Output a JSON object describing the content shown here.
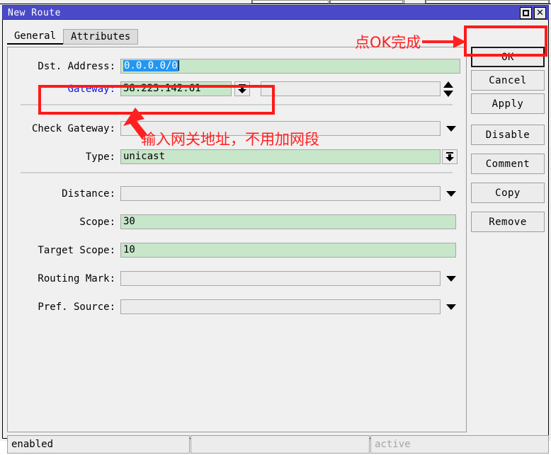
{
  "window": {
    "title": "New Route",
    "maximize_icon": "maximize-icon",
    "close_icon": "close-icon",
    "close_glyph": "✕"
  },
  "tabs": [
    {
      "label": "General",
      "active": true
    },
    {
      "label": "Attributes",
      "active": false
    }
  ],
  "form": {
    "fields": [
      {
        "key": "dst_address",
        "label": "Dst. Address:",
        "value": "0.0.0.0/0",
        "style": "green",
        "selected": true,
        "control": "none"
      },
      {
        "key": "gateway",
        "label": "Gateway:",
        "value": "58.223.142.61",
        "style": "green",
        "selected": false,
        "control": "combo-button",
        "label_link": true
      },
      {
        "key": "gateway_extra",
        "label": "",
        "value": "",
        "style": "plain",
        "selected": false,
        "control": "spinner"
      },
      {
        "key": "check_gateway",
        "label": "Check Gateway:",
        "value": "",
        "style": "plain",
        "selected": false,
        "control": "dropdown"
      },
      {
        "key": "type",
        "label": "Type:",
        "value": "unicast",
        "style": "green",
        "selected": false,
        "control": "combo-button"
      },
      {
        "key": "distance",
        "label": "Distance:",
        "value": "",
        "style": "plain",
        "selected": false,
        "control": "dropdown"
      },
      {
        "key": "scope",
        "label": "Scope:",
        "value": "30",
        "style": "green",
        "selected": false,
        "control": "none"
      },
      {
        "key": "target_scope",
        "label": "Target Scope:",
        "value": "10",
        "style": "green",
        "selected": false,
        "control": "none"
      },
      {
        "key": "routing_mark",
        "label": "Routing Mark:",
        "value": "",
        "style": "plain",
        "selected": false,
        "control": "dropdown"
      },
      {
        "key": "pref_source",
        "label": "Pref. Source:",
        "value": "",
        "style": "plain",
        "selected": false,
        "control": "dropdown"
      }
    ]
  },
  "buttons": [
    {
      "label": "OK",
      "default": true
    },
    {
      "label": "Cancel",
      "default": false
    },
    {
      "label": "Apply",
      "default": false
    },
    {
      "label": "Disable",
      "default": false
    },
    {
      "label": "Comment",
      "default": false
    },
    {
      "label": "Copy",
      "default": false
    },
    {
      "label": "Remove",
      "default": false
    }
  ],
  "status": {
    "left": "enabled",
    "middle": "",
    "right": "active"
  },
  "annotations": {
    "accent_color": "#ff2020",
    "ok_note": "点OK完成",
    "gateway_note": "输入网关地址，不用加网段"
  }
}
